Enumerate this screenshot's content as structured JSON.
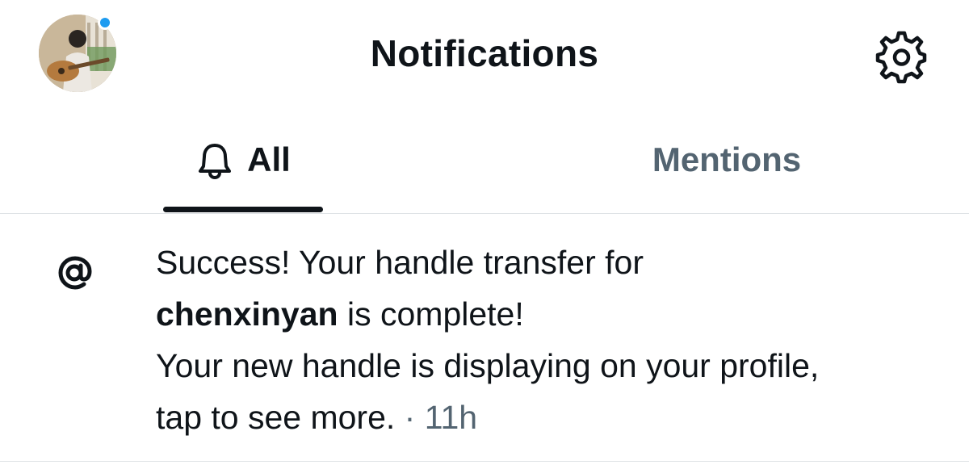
{
  "header": {
    "title": "Notifications",
    "avatar_icon": "user-avatar",
    "unread_dot_color": "#1d9bf0",
    "settings_icon": "gear-icon"
  },
  "tabs": [
    {
      "label": "All",
      "icon": "bell-icon",
      "active": true
    },
    {
      "label": "Mentions",
      "active": false
    }
  ],
  "notification": {
    "icon": "at-sign-icon",
    "line1": "Success! Your handle transfer for",
    "handle": "chenxinyan",
    "line2_rest": " is complete!",
    "line3": "Your new handle is displaying on your profile,",
    "line4": "tap to see more.",
    "separator": " · ",
    "time": "11h"
  },
  "colors": {
    "text": "#0f1419",
    "muted": "#536471",
    "accent": "#1d9bf0",
    "divider": "#dfe3e6"
  }
}
